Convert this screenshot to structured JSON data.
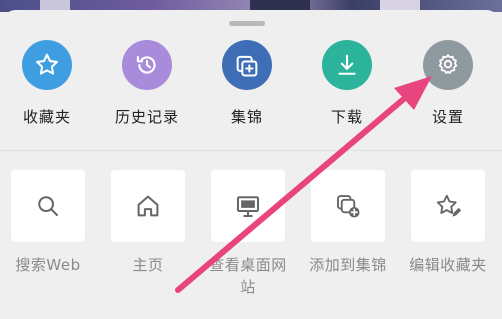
{
  "colors": {
    "sheet_bg": "#efefef",
    "favorites_circle": "#3f9ee1",
    "history_circle": "#a98bdc",
    "collections_circle": "#3e6fb6",
    "downloads_circle": "#2bb39c",
    "settings_circle": "#8f9aa0",
    "annotation_arrow": "#e8457f"
  },
  "quick_actions": [
    {
      "label": "收藏夹",
      "icon": "star-icon"
    },
    {
      "label": "历史记录",
      "icon": "history-icon"
    },
    {
      "label": "集锦",
      "icon": "collections-icon"
    },
    {
      "label": "下载",
      "icon": "download-icon"
    },
    {
      "label": "设置",
      "icon": "gear-icon"
    }
  ],
  "shortcuts": [
    {
      "label": "搜索Web",
      "icon": "search-icon"
    },
    {
      "label": "主页",
      "icon": "home-icon"
    },
    {
      "label": "查看桌面网站",
      "icon": "desktop-icon"
    },
    {
      "label": "添加到集锦",
      "icon": "add-to-collection-icon"
    },
    {
      "label": "编辑收藏夹",
      "icon": "edit-favorite-icon"
    }
  ]
}
